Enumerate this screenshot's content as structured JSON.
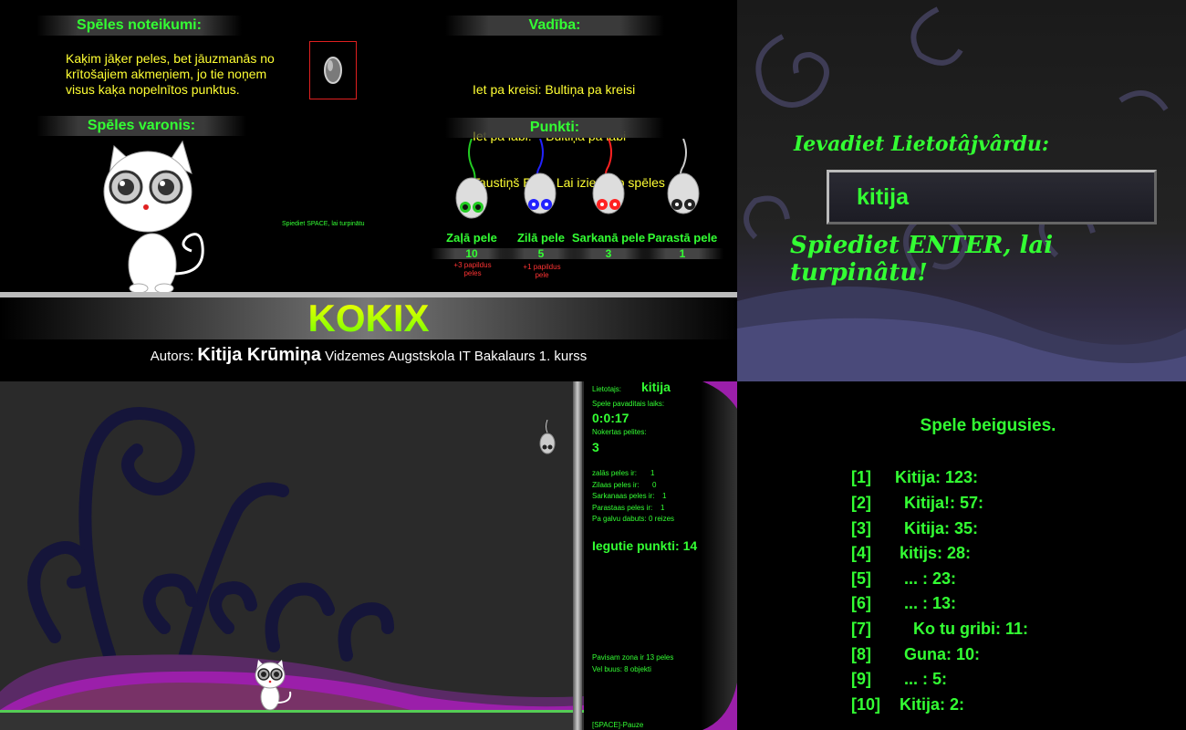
{
  "rules": {
    "heading": "Spēles noteikumi:",
    "text": [
      "Kaķim jāķer peles, bet jāuzmanās no",
      "krītošajiem akmeņiem, jo tie noņem",
      "visus kaķa nopelnītos punktus."
    ],
    "hero_heading": "Spēles varonis:",
    "controls_heading": "Vadība:",
    "controls": [
      "Iet pa kreisi: Bultiņa pa kreisi",
      "Iet pa labi:    Bultiņa pa labi",
      "Taustiņš ESC: Lai izietu no spēles"
    ],
    "space_hint": "Spiediet SPACE, lai turpinātu",
    "points_heading": "Punkti:",
    "mice": [
      {
        "name": "Zaļā pele",
        "points": "10",
        "bonus": "+3 papildus peles",
        "color": "#22cc22"
      },
      {
        "name": "Zilā pele",
        "points": "5",
        "bonus": "+1 papildus pele",
        "color": "#2222ff"
      },
      {
        "name": "Sarkanā pele",
        "points": "3",
        "bonus": "",
        "color": "#ff2222"
      },
      {
        "name": "Parastā pele",
        "points": "1",
        "bonus": "",
        "color": "#222222"
      }
    ],
    "logo": "KOKIX",
    "author_label": "Autors:",
    "author_name": "Kitija Krūmiņa",
    "author_info": "Vidzemes Augstskola IT Bakalaurs 1. kurss"
  },
  "login": {
    "prompt": "Ievadiet Lietotâjvârdu:",
    "username_value": "kitija",
    "enter_hint": "Spiediet ENTER, lai turpinâtu!"
  },
  "game": {
    "user_label": "Lietotajs:",
    "user_value": "kitija",
    "time_label": "Spele pavaditais laiks:",
    "time_value": "0:0:17",
    "caught_label": "Nokertas pelites:",
    "caught_value": "3",
    "stats": [
      {
        "label": "zalās peles ir:",
        "value": "1"
      },
      {
        "label": "Zilaas peles ir:",
        "value": "0"
      },
      {
        "label": "Sarkanaas peles ir:",
        "value": "1"
      },
      {
        "label": "Parastaas peles ir:",
        "value": "1"
      },
      {
        "label": "Pa galvu dabuts:",
        "value": "0 reizes"
      }
    ],
    "points_label": "Iegutie punkti:",
    "points_value": "14",
    "zone_info": "Pavisam zona ir 13 peles",
    "left_info": "Vel buus: 8 objekti",
    "pause_hint": "[SPACE]-Pauze"
  },
  "scores": {
    "title": "Spele beigusies.",
    "rows": [
      {
        "rank": "[1]",
        "entry": "Kitija: 123:"
      },
      {
        "rank": "[2]",
        "entry": "  Kitija!: 57:"
      },
      {
        "rank": "[3]",
        "entry": "  Kitija: 35:"
      },
      {
        "rank": "[4]",
        "entry": " kitijs: 28:"
      },
      {
        "rank": "[5]",
        "entry": "  ... : 23:"
      },
      {
        "rank": "[6]",
        "entry": "  ... : 13:"
      },
      {
        "rank": "[7]",
        "entry": "    Ko tu gribi: 11:"
      },
      {
        "rank": "[8]",
        "entry": "  Guna: 10:"
      },
      {
        "rank": "[9]",
        "entry": "  ... : 5:"
      },
      {
        "rank": "[10]",
        "entry": " Kitija: 2:"
      }
    ]
  }
}
